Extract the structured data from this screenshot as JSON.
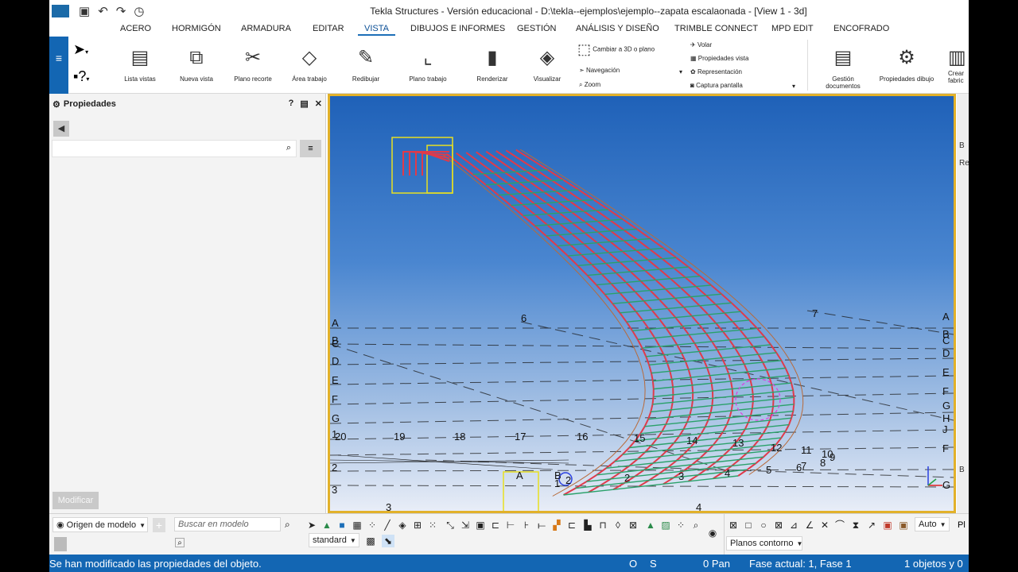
{
  "window": {
    "title": "Tekla Structures - Versión educacional - D:\\tekla--ejemplos\\ejemplo--zapata escalaonada  - [View 1 -  3d]"
  },
  "quick_access": {
    "save_icon": "save-icon",
    "undo_icon": "undo-icon",
    "redo_icon": "redo-icon",
    "history_icon": "history-icon"
  },
  "menu": {
    "tabs": [
      "ACERO",
      "HORMIGÓN",
      "ARMADURA",
      "EDITAR",
      "VISTA",
      "DIBUJOS E INFORMES",
      "GESTIÓN",
      "ANÁLISIS Y DISEÑO",
      "TRIMBLE CONNECT",
      "MPD EDIT",
      "ENCOFRADO"
    ],
    "active": "VISTA"
  },
  "ribbon": {
    "buttons": [
      {
        "label": "Lista vistas",
        "icon": "view-list-icon"
      },
      {
        "label": "Nueva vista",
        "icon": "new-view-icon"
      },
      {
        "label": "Plano recorte",
        "icon": "scissors-icon"
      },
      {
        "label": "Área trabajo",
        "icon": "work-area-icon"
      },
      {
        "label": "Redibujar",
        "icon": "redraw-icon"
      },
      {
        "label": "Plano trabajo",
        "icon": "work-plane-icon"
      },
      {
        "label": "Renderizar",
        "icon": "render-icon"
      },
      {
        "label": "Visualizar",
        "icon": "display-icon"
      }
    ],
    "small": {
      "switch_3d": "Cambiar a 3D o plano",
      "navegacion": "Navegación",
      "zoom": "Zoom",
      "volar": "Volar",
      "propiedades_vista": "Propiedades vista",
      "representacion": "Representación",
      "captura": "Captura pantalla"
    },
    "right_buttons": [
      {
        "label": "Gestión documentos",
        "icon": "document-manager-icon"
      },
      {
        "label": "Propiedades dibujo",
        "icon": "drawing-properties-icon"
      },
      {
        "label": "Crear fabric",
        "icon": "fabricate-icon"
      }
    ]
  },
  "properties_panel": {
    "title": "Propiedades",
    "search_placeholder": "",
    "modify_button": "Modificar"
  },
  "viewport": {
    "grid_labels_left": [
      "A",
      "B",
      "C",
      "D",
      "E",
      "F",
      "G",
      "1",
      "2",
      "3"
    ],
    "grid_labels_right": [
      "A",
      "B",
      "C",
      "D",
      "E",
      "F",
      "G",
      "H",
      "J",
      "F",
      "G"
    ],
    "grid_numbers_bottom": [
      "20",
      "19",
      "18",
      "17",
      "16",
      "15",
      "14",
      "13",
      "12",
      "11",
      "10",
      "9",
      "8",
      "7",
      "6",
      "5",
      "4",
      "3",
      "2"
    ],
    "top_numbers": [
      "6",
      "7"
    ],
    "lower_left_labels": [
      "A",
      "B",
      "1",
      "2",
      "3",
      "4"
    ],
    "colors": {
      "sky_top": "#1f61b8",
      "sky_bottom": "#e8edf7",
      "rebar_red": "#e03a4a",
      "rebar_green": "#2aa16a",
      "border": "#e2b12a"
    }
  },
  "right_strip": {
    "labels": [
      "B",
      "Re",
      "B"
    ]
  },
  "bottom": {
    "origin": "Origen de modelo",
    "search_placeholder": "Buscar en modelo",
    "filter": "standard",
    "auto": "Auto",
    "planos": "Planos contorno",
    "pl": "Pl"
  },
  "status": {
    "message": "Se han modificado las propiedades del objeto.",
    "o": "O",
    "s": "S",
    "pan": "0 Pan",
    "fase": "Fase actual: 1, Fase 1",
    "objetos": "1 objetos y 0"
  }
}
